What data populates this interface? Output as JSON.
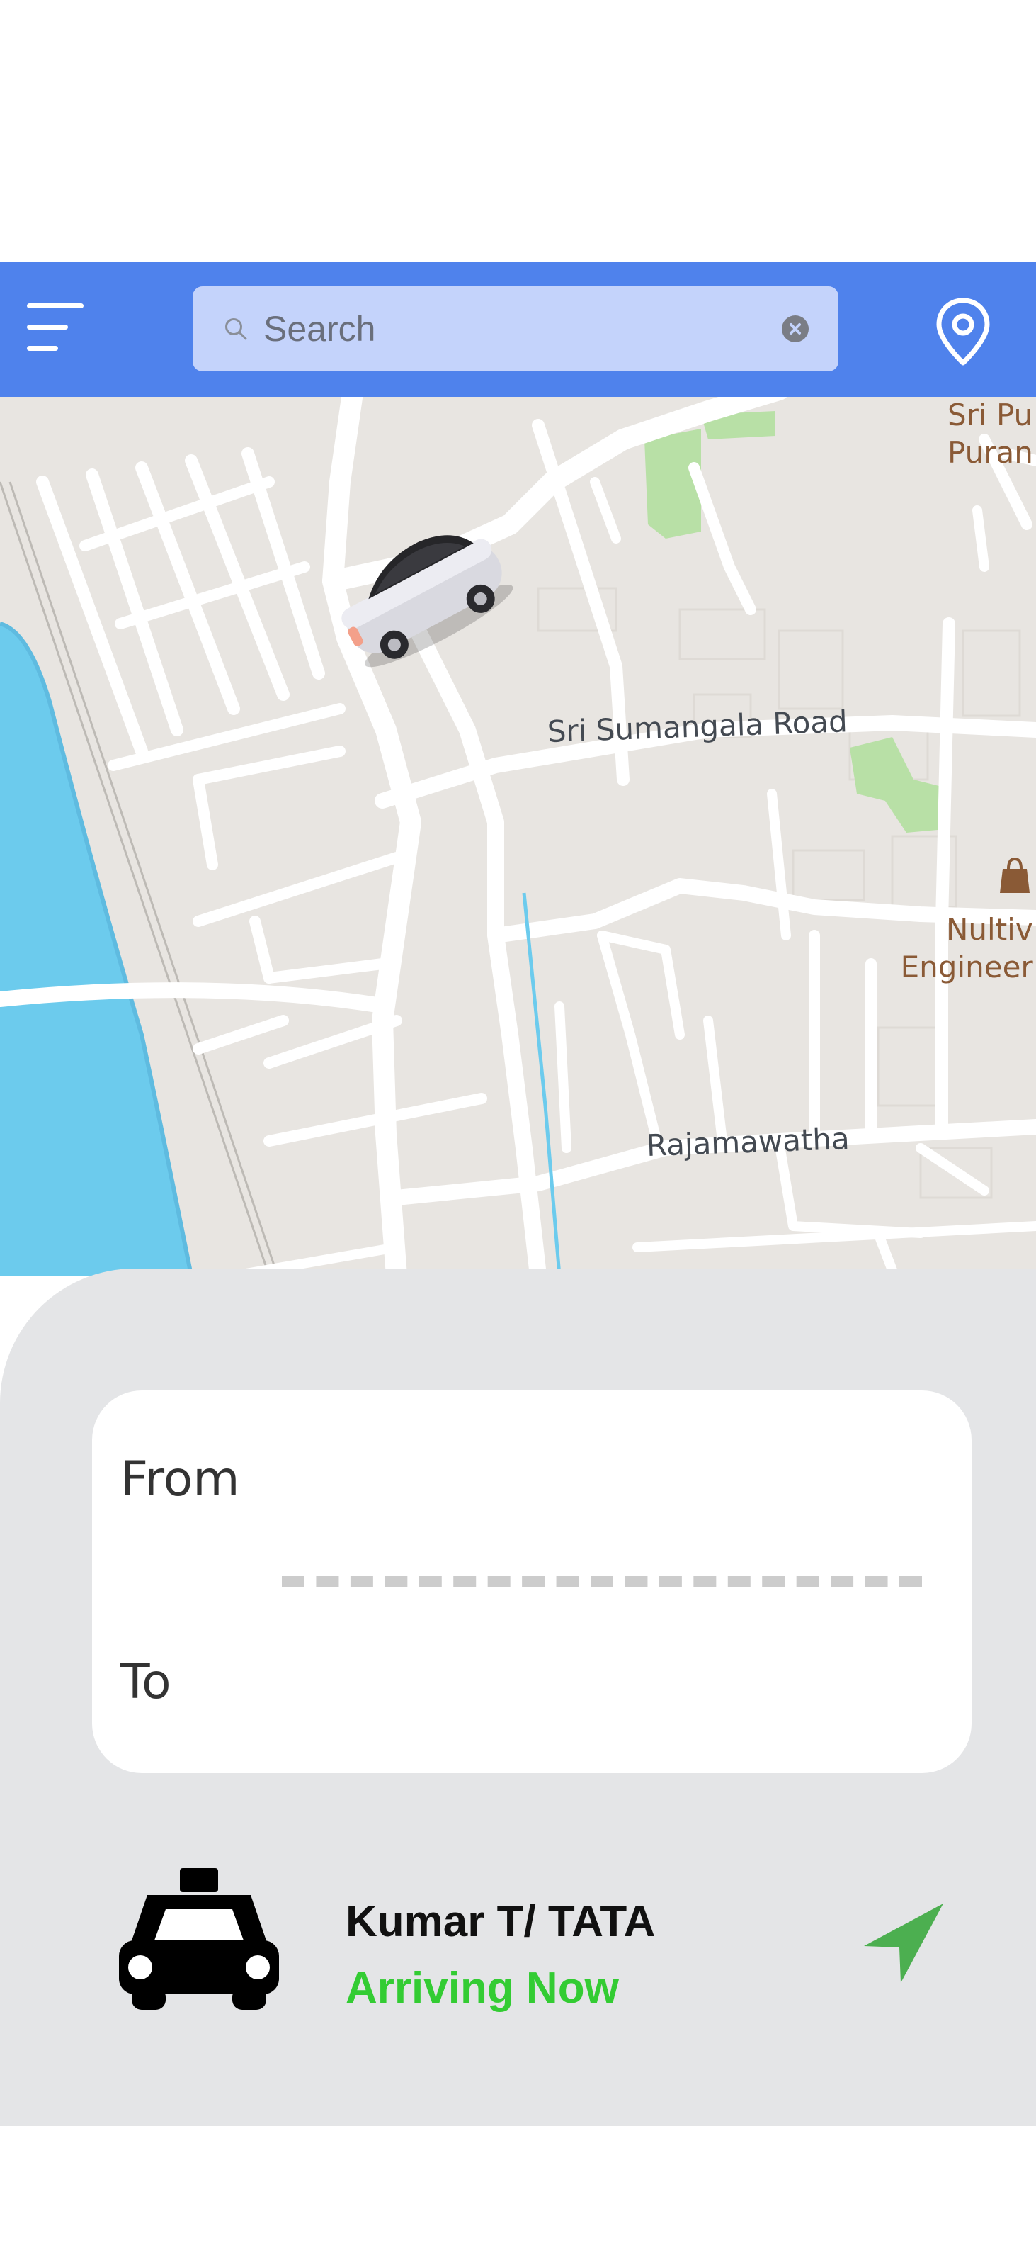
{
  "header": {
    "search_placeholder": "Search"
  },
  "map": {
    "labels": {
      "road_1": "Sri Sumangala Road",
      "road_2": "Rajamawatha",
      "poi_top_line1": "Sri Pu",
      "poi_top_line2": "Puran",
      "poi_right_line1": "Nultiv",
      "poi_right_line2": "Engineer"
    }
  },
  "route": {
    "from_label": "From",
    "to_label": "To"
  },
  "driver": {
    "name": "Kumar T/ TATA",
    "status": "Arriving Now"
  },
  "colors": {
    "header_bg": "#4f82ec",
    "search_bg": "#c4d3fb",
    "water": "#6ccbed",
    "park": "#b8e0a6",
    "status_green": "#33cc33",
    "nav_green": "#4caf50",
    "sheet_bg": "#e4e5e7"
  },
  "icons": {
    "menu": "hamburger-menu-icon",
    "search": "search-icon",
    "clear": "clear-icon",
    "location": "location-pin-icon",
    "car": "car-marker-icon",
    "taxi": "taxi-icon",
    "navigate": "navigation-arrow-icon"
  }
}
